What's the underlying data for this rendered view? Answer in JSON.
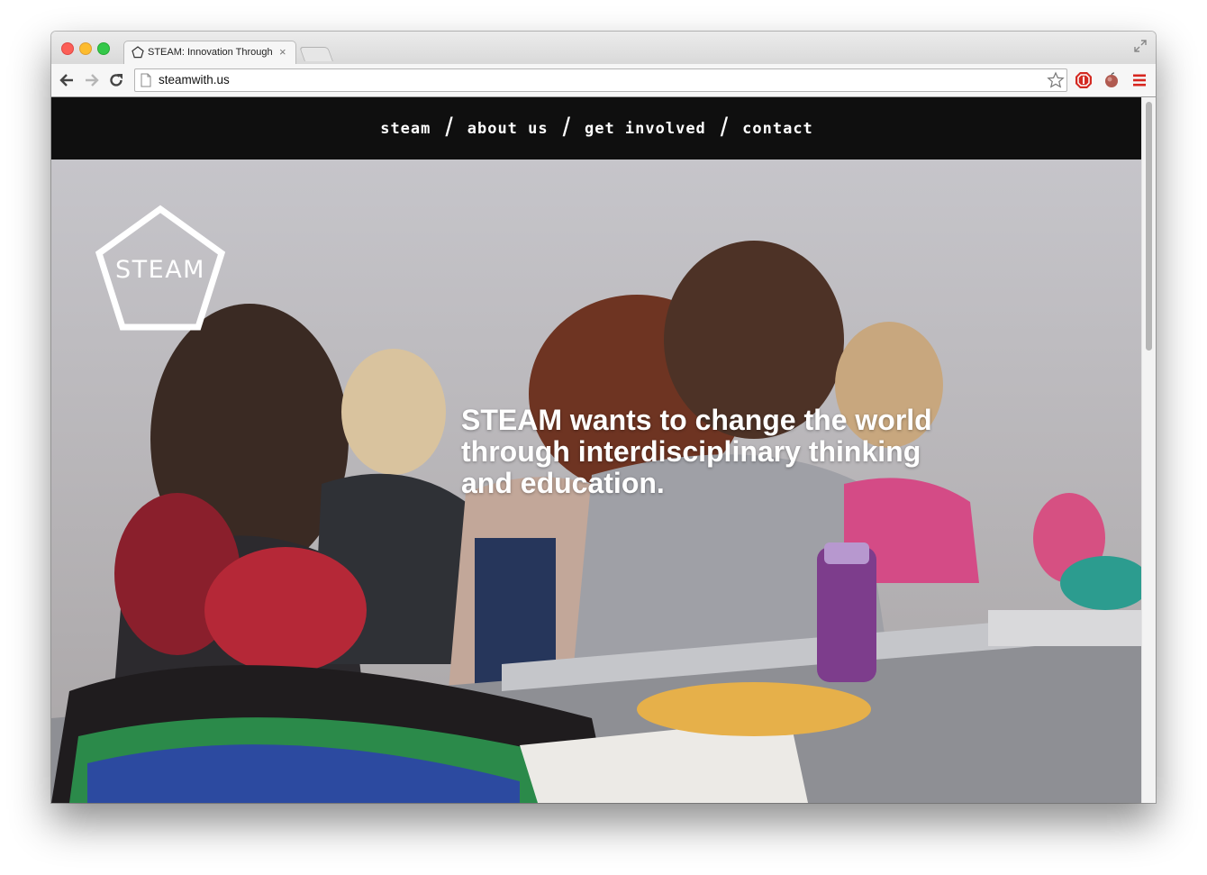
{
  "browser": {
    "tab_title": "STEAM: Innovation Through Interdisciplinary",
    "tab_close": "×",
    "url": "steamwith.us"
  },
  "nav": {
    "items": [
      {
        "label": "steam"
      },
      {
        "label": "about us"
      },
      {
        "label": "get involved"
      },
      {
        "label": "contact"
      }
    ],
    "separator": "/"
  },
  "hero": {
    "logo_text": "STEAM",
    "tagline_lines": [
      "STEAM wants to change the world",
      "through interdisciplinary thinking",
      "and education."
    ]
  },
  "icons": {
    "back": "arrow-left-icon",
    "forward": "arrow-right-icon",
    "reload": "reload-icon",
    "bookmark": "star-icon",
    "adblock": "stop-icon",
    "extension": "apple-icon",
    "menu": "hamburger-icon"
  },
  "colors": {
    "nav_bg": "#0f0f0f",
    "nav_text": "#ffffff",
    "menu_red": "#d7261f"
  }
}
